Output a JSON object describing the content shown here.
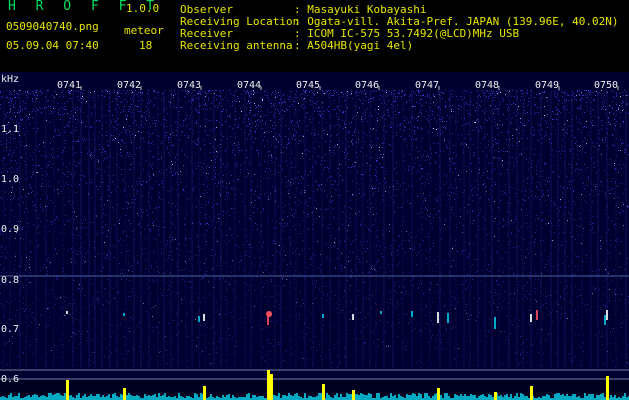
{
  "app": {
    "name": "H R O F F T",
    "version": "1.0.0",
    "file_name": "0509040740.png",
    "datetime": "05.09.04 07:40",
    "meteor_label": "meteor",
    "meteor_count": "18"
  },
  "meta": [
    {
      "label": "Observer",
      "value": ": Masayuki Kobayashi"
    },
    {
      "label": "Receiving Location",
      "value": ": Ogata-vill. Akita-Pref. JAPAN (139.96E, 40.02N)"
    },
    {
      "label": "Receiver",
      "value": ": ICOM IC-575 53.7492(@LCD)MHz USB"
    },
    {
      "label": "Receiving antenna",
      "value": ": A504HB(yagi 4el)"
    }
  ],
  "spectrogram": {
    "unit_label": "kHz",
    "time_labels": [
      "0741",
      "0742",
      "0743",
      "0744",
      "0745",
      "0746",
      "0747",
      "0748",
      "0749",
      "0750"
    ],
    "freq_labels": [
      "1.1",
      "1.0",
      "0.9",
      "0.8",
      "0.7",
      "0.6"
    ],
    "colors": {
      "background": "#000030",
      "noise": "#3a3ad0",
      "bright": "#c0c8ff",
      "echo": "#ff5060",
      "signal_line": "#00c8e0",
      "spike": "#ffff00"
    }
  }
}
